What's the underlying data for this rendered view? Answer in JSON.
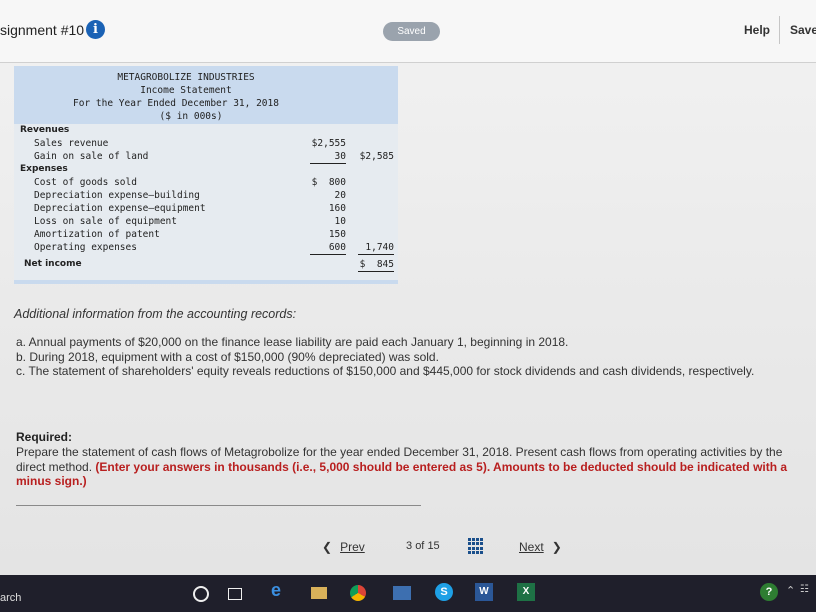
{
  "header": {
    "assignment_title": "signment #10",
    "info_icon": "i",
    "saved_label": "Saved",
    "help_label": "Help",
    "save_label": "Save"
  },
  "income_statement": {
    "company": "METAGROBOLIZE INDUSTRIES",
    "title": "Income Statement",
    "period": "For the Year Ended December 31, 2018",
    "units": "($ in 000s)",
    "revenues_label": "Revenues",
    "sales_revenue_label": "Sales revenue",
    "sales_revenue_value": "$2,555",
    "gain_land_label": "Gain on sale of land",
    "gain_land_value": "30",
    "total_revenues": "$2,585",
    "expenses_label": "Expenses",
    "expenses": [
      {
        "label": "Cost of goods sold",
        "value": "$  800"
      },
      {
        "label": "Depreciation expense—building",
        "value": "20"
      },
      {
        "label": "Depreciation expense—equipment",
        "value": "160"
      },
      {
        "label": "Loss on sale of equipment",
        "value": "10"
      },
      {
        "label": "Amortization of patent",
        "value": "150"
      },
      {
        "label": "Operating expenses",
        "value": "600"
      }
    ],
    "total_expenses": "1,740",
    "net_income_label": "Net income",
    "net_income_value": "$  845"
  },
  "additional": {
    "heading": "Additional information from the accounting records:",
    "item_a": "a. Annual payments of $20,000 on the finance lease liability are paid each January 1, beginning in 2018.",
    "item_b": "b. During 2018, equipment with a cost of $150,000 (90% depreciated) was sold.",
    "item_c": "c. The statement of shareholders' equity reveals reductions of $150,000 and $445,000 for stock dividends and cash dividends, respectively."
  },
  "required": {
    "label": "Required:",
    "text": "Prepare the statement of cash flows of Metagrobolize for the year ended December 31, 2018. Present cash flows from operating activities by the direct method.",
    "emphasis": "(Enter your answers in thousands (i.e., 5,000 should be entered as 5). Amounts to be deducted should be indicated with a minus sign.)"
  },
  "navigation": {
    "prev_label": "Prev",
    "page_current": "3",
    "page_of": "of",
    "page_total": "15",
    "next_label": "Next"
  },
  "taskbar": {
    "search_text": "arch",
    "word_letter": "W",
    "excel_letter": "X",
    "skype_letter": "S",
    "help_letter": "?"
  }
}
